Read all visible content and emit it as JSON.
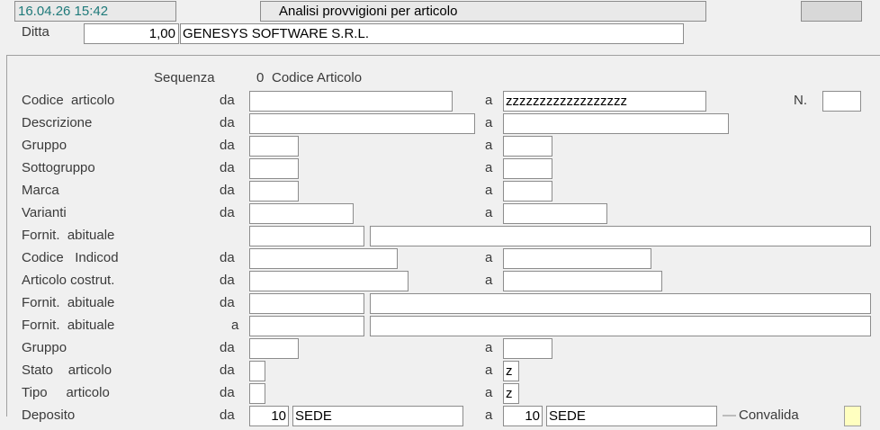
{
  "header": {
    "datetime": "16.04.26 15:42",
    "title": "Analisi provvigioni per articolo",
    "ditta_label": "Ditta",
    "ditta_code": "1,00",
    "ditta_name": "GENESYS SOFTWARE S.R.L."
  },
  "sequenza": {
    "label": "Sequenza",
    "value": "0",
    "desc": "Codice Articolo"
  },
  "rows": [
    {
      "label": "Codice  articolo",
      "da": "da",
      "a": "a",
      "to_value": "zzzzzzzzzzzzzzzzzz",
      "n_label": "N."
    },
    {
      "label": "Descrizione",
      "da": "da",
      "a": "a"
    },
    {
      "label": "Gruppo",
      "da": "da",
      "a": "a"
    },
    {
      "label": "Sottogruppo",
      "da": "da",
      "a": "a"
    },
    {
      "label": "Marca",
      "da": "da",
      "a": "a"
    },
    {
      "label": "Varianti",
      "da": "da",
      "a": "a"
    },
    {
      "label": "Fornit.  abituale"
    },
    {
      "label": "Codice   Indicod",
      "da": "da",
      "a": "a"
    },
    {
      "label": "Articolo costrut.",
      "da": "da",
      "a": "a"
    },
    {
      "label": "Fornit.  abituale",
      "da": "da"
    },
    {
      "label": "Fornit.  abituale",
      "a": "a"
    },
    {
      "label": "Gruppo",
      "da": "da",
      "a": "a"
    },
    {
      "label": "Stato    articolo",
      "da": "da",
      "a": "a",
      "to_value": "z"
    },
    {
      "label": "Tipo     articolo",
      "da": "da",
      "a": "a",
      "to_value": "z"
    },
    {
      "label": "Deposito",
      "da": "da",
      "a": "a",
      "from_code": "10",
      "from_name": "SEDE",
      "to_code": "10",
      "to_name": "SEDE"
    }
  ],
  "convalida": {
    "label": "Convalida",
    "dash": "—"
  },
  "colors": {
    "datetime_text": "#1f7a7a",
    "header_bg": "#e9e9e9",
    "convalida_bg": "#ffffc0"
  }
}
